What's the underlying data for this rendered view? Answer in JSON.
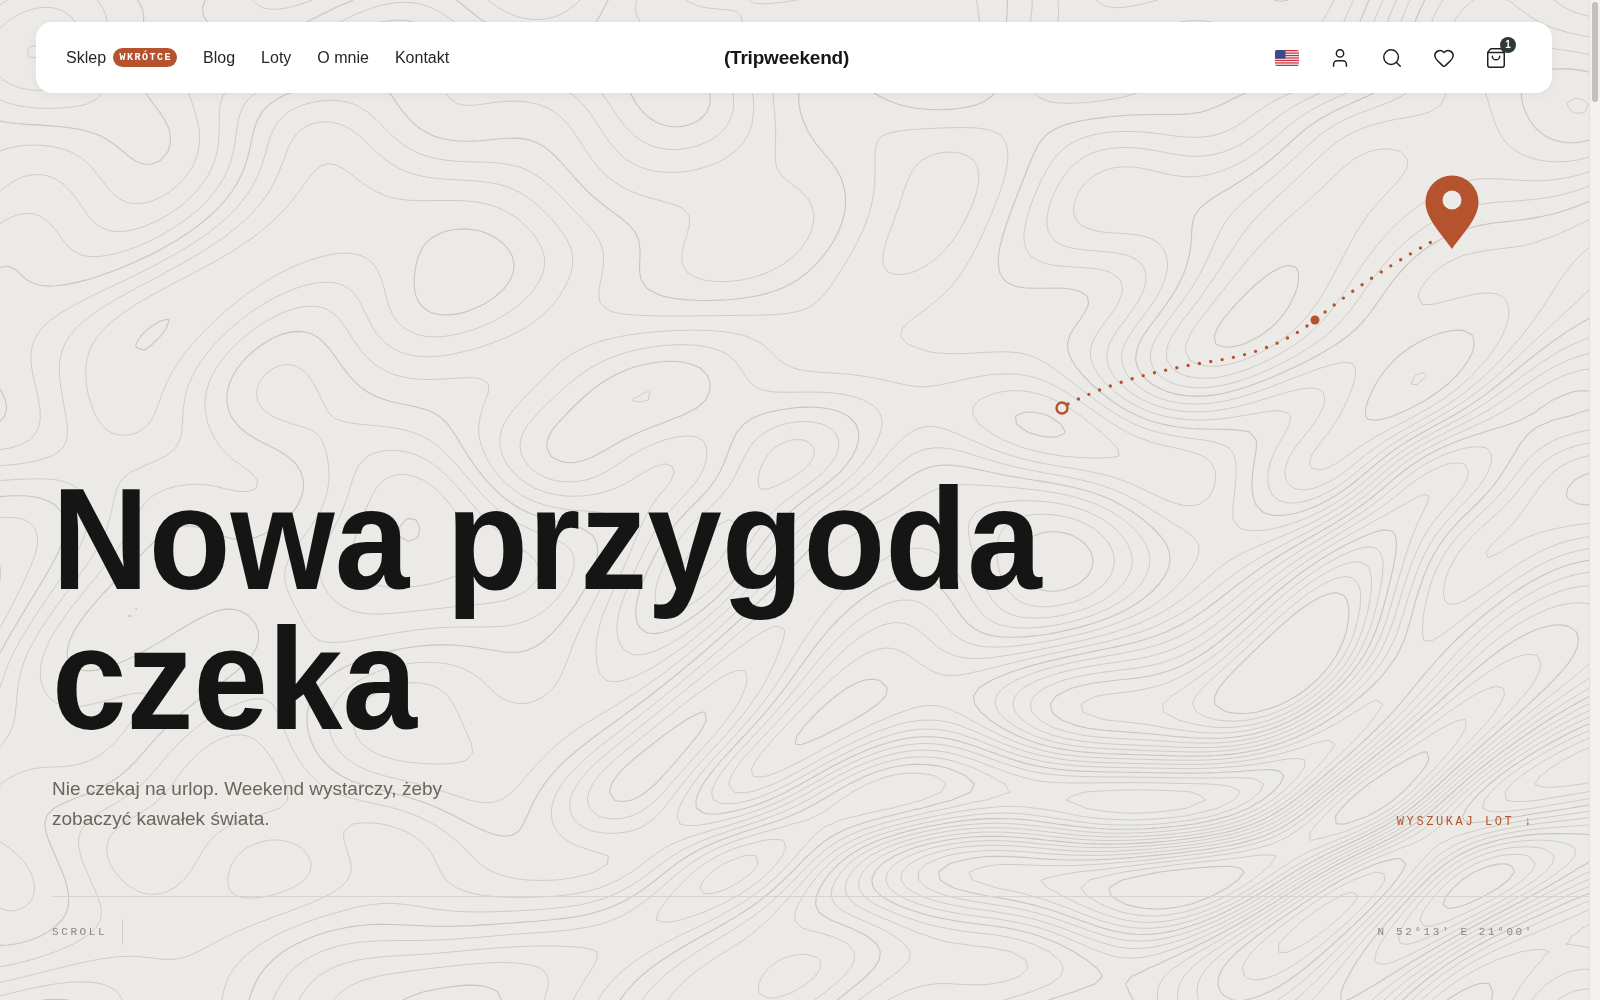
{
  "nav": {
    "links": [
      {
        "label": "Sklep",
        "badge": "WKRÓTCE"
      },
      {
        "label": "Blog"
      },
      {
        "label": "Loty"
      },
      {
        "label": "O mnie"
      },
      {
        "label": "Kontakt"
      }
    ],
    "logo": "(Tripweekend)",
    "cart_count": "1"
  },
  "hero": {
    "title": "Nowa przygoda czeka",
    "subtitle": "Nie czekaj na urlop. Weekend wystarczy, żeby zobaczyć kawałek świata.",
    "cta": "WYSZUKAJ LOT ↓"
  },
  "footer": {
    "scroll_label": "SCROLL",
    "coordinates": "N 52°13' E 21°00'"
  }
}
